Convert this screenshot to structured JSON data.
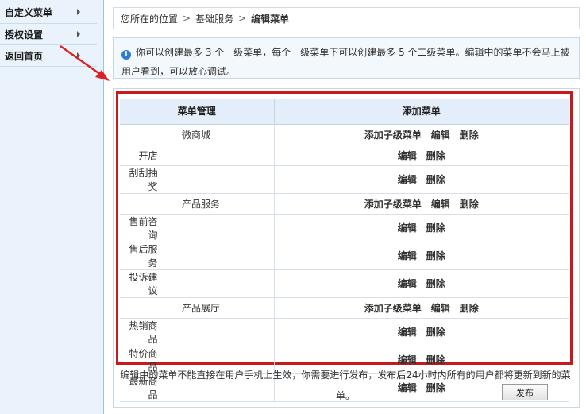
{
  "sidebar": {
    "items": [
      {
        "label": "自定义菜单"
      },
      {
        "label": "授权设置"
      },
      {
        "label": "返回首页"
      }
    ]
  },
  "breadcrumb": {
    "prefix": "您所在的位置",
    "sep": ">",
    "level1": "基础服务",
    "current": "编辑菜单"
  },
  "notice": {
    "text": "你可以创建最多 3 个一级菜单，每个一级菜单下可以创建最多 5 个二级菜单。编辑中的菜单不会马上被用户看到，可以放心调试。"
  },
  "table": {
    "header_col1": "菜单管理",
    "header_col2": "添加菜单",
    "op_add_child": "添加子级菜单",
    "op_edit": "编辑",
    "op_delete": "删除",
    "rows": [
      {
        "name": "微商城",
        "level": 1
      },
      {
        "name": "开店",
        "level": 2
      },
      {
        "name": "刮刮抽奖",
        "level": 2
      },
      {
        "name": "产品服务",
        "level": 1
      },
      {
        "name": "售前咨询",
        "level": 2
      },
      {
        "name": "售后服务",
        "level": 2
      },
      {
        "name": "投诉建议",
        "level": 2
      },
      {
        "name": "产品展厅",
        "level": 1
      },
      {
        "name": "热销商品",
        "level": 2
      },
      {
        "name": "特价商品",
        "level": 2
      },
      {
        "name": "最新商品",
        "level": 2
      }
    ]
  },
  "footer": {
    "note": "编辑中的菜单不能直接在用户手机上生效，你需要进行发布，发布后24小时内所有的用户都将更新到新的菜单。",
    "publish_label": "发布"
  },
  "colors": {
    "highlight": "#c81a1e",
    "sidebar_bg": "#eaf3fb",
    "header_bg": "#e4eefa"
  }
}
